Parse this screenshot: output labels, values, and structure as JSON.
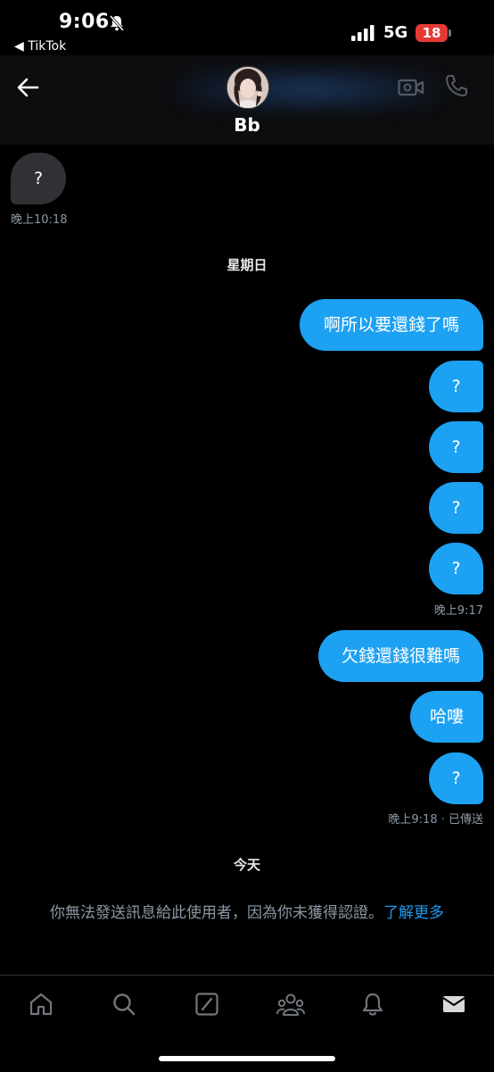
{
  "status": {
    "time": "9:06",
    "back_app": "◀ TikTok",
    "network": "5G",
    "battery": "18"
  },
  "header": {
    "contact_name": "Bb"
  },
  "messages": {
    "in_1": "?",
    "in_1_time": "晚上10:18",
    "divider_1": "星期日",
    "out_1": "啊所以要還錢了嗎",
    "out_2": "?",
    "out_3": "?",
    "out_4": "?",
    "out_5": "?",
    "out_5_time": "晚上9:17",
    "out_6": "欠錢還錢很難嗎",
    "out_7": "哈嘍",
    "out_8": "?",
    "out_8_time": "晚上9:18 · 已傳送",
    "divider_2": "今天"
  },
  "notice": {
    "text": "你無法發送訊息給此使用者，因為你未獲得認證。",
    "link": "了解更多"
  },
  "colors": {
    "accent": "#1da1f2",
    "incoming_bubble": "#2f3134",
    "meta_text": "#8b98a5"
  },
  "icons": {
    "nav": [
      "home-icon",
      "search-icon",
      "grok-icon",
      "communities-icon",
      "notifications-icon",
      "messages-icon"
    ]
  }
}
